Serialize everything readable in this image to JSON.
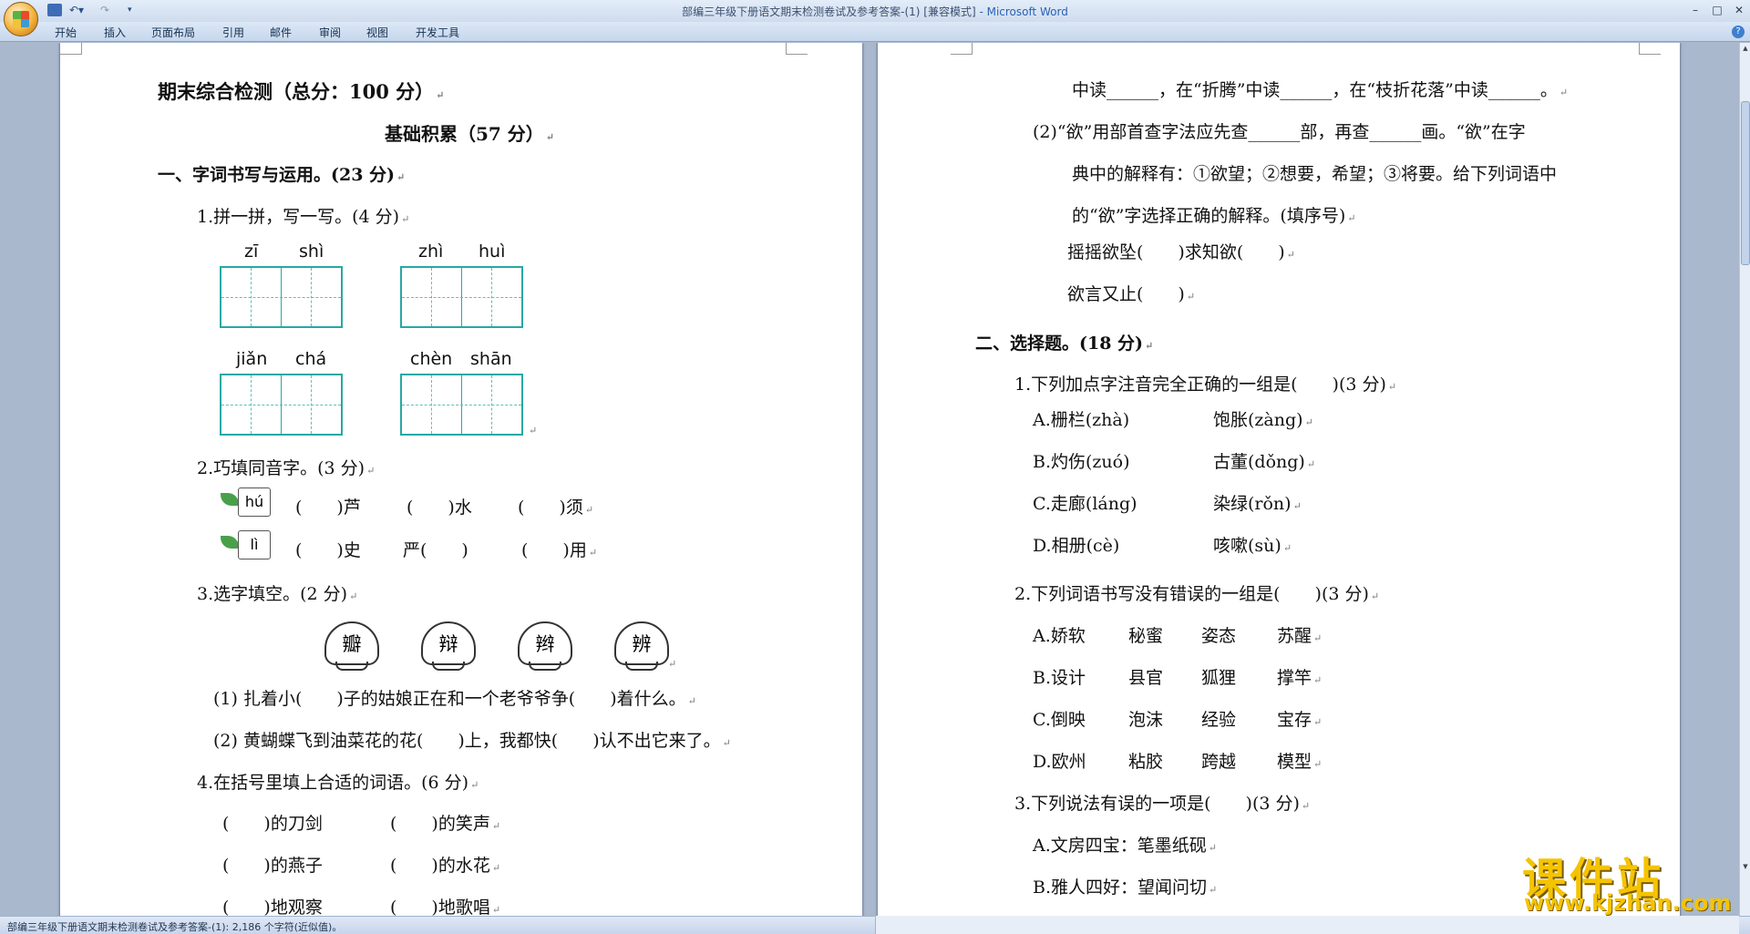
{
  "window": {
    "title": "部编三年级下册语文期末检测卷试及参考答案-(1) [兼容模式]",
    "app": " - Microsoft Word"
  },
  "ribbon": {
    "tabs": [
      "开始",
      "插入",
      "页面布局",
      "引用",
      "邮件",
      "审阅",
      "视图",
      "开发工具"
    ]
  },
  "status": {
    "text": "部编三年级下册语文期末检测卷试及参考答案-(1): 2,186 个字符(近似值)。"
  },
  "watermark": {
    "title": "课件站",
    "url": "www.kjzhan.com"
  },
  "left": {
    "title": "期末综合检测（总分：100 分）",
    "subtitle": "基础积累（57 分）",
    "sec1": "一、字词书写与运用。(23 分)",
    "q1": "1.拼一拼，写一写。(4 分)",
    "pinyin": [
      {
        "a": "zī",
        "b": "shì"
      },
      {
        "a": "zhì",
        "b": "huì"
      },
      {
        "a": "jiǎn",
        "b": "chá"
      },
      {
        "a": "chèn",
        "b": "shān"
      }
    ],
    "q2": "2.巧填同音字。(3 分)",
    "hu_tag": "hú",
    "hu_blanks": [
      "(　　)芦",
      "(　　)水",
      "(　　)须"
    ],
    "li_tag": "lì",
    "li_blanks": [
      "(　　)史",
      "严(　　)",
      "(　　)用"
    ],
    "q3": "3.选字填空。(2 分)",
    "shells": [
      "瓣",
      "辩",
      "辫",
      "辨"
    ],
    "q3_1": "(1) 扎着小(　　)子的姑娘正在和一个老爷爷争(　　)着什么。",
    "q3_2": "(2) 黄蝴蝶飞到油菜花的花(　　)上，我都快(　　)认不出它来了。",
    "q4": "4.在括号里填上合适的词语。(6 分)",
    "q4_rows": [
      [
        "(　　)的刀剑",
        "(　　)的笑声"
      ],
      [
        "(　　)的燕子",
        "(　　)的水花"
      ],
      [
        "(　　)地观察",
        "(　　)地歌唱"
      ]
    ]
  },
  "right": {
    "top_line": "中读______，在“折腾”中读______，在“枝折花落”中读______。",
    "q2_line1": "(2)“欲”用部首查字法应先查______部，再查______画。“欲”在字",
    "q2_line2": "典中的解释有：①欲望；②想要，希望；③将要。给下列词语中",
    "q2_line3": "的“欲”字选择正确的解释。(填序号)",
    "yu1": "摇摇欲坠(　　)求知欲(　　)",
    "yu2": "欲言又止(　　)",
    "sec2": "二、选择题。(18 分)",
    "c1": "1.下列加点字注音完全正确的一组是(　　)(3 分)",
    "c1_opts": [
      [
        "A.栅栏(zhà)",
        "饱胀(zàng)"
      ],
      [
        "B.灼伤(zuó)",
        "古董(dǒng)"
      ],
      [
        "C.走廊(láng)",
        "染绿(rǒn)"
      ],
      [
        "D.相册(cè)",
        "咳嗽(sù)"
      ]
    ],
    "c2": "2.下列词语书写没有错误的一组是(　　)(3 分)",
    "c2_opts": [
      [
        "A.娇软",
        "秘蜜",
        "姿态",
        "苏醒"
      ],
      [
        "B.设计",
        "县官",
        "狐狸",
        "撑竿"
      ],
      [
        "C.倒映",
        "泡沫",
        "经验",
        "宝存"
      ],
      [
        "D.欧州",
        "粘胶",
        "跨越",
        "模型"
      ]
    ],
    "c3": "3.下列说法有误的一项是(　　)(3 分)",
    "c3_opts": [
      "A.文房四宝：笔墨纸砚",
      "B.雅人四好：望闻问切"
    ]
  }
}
